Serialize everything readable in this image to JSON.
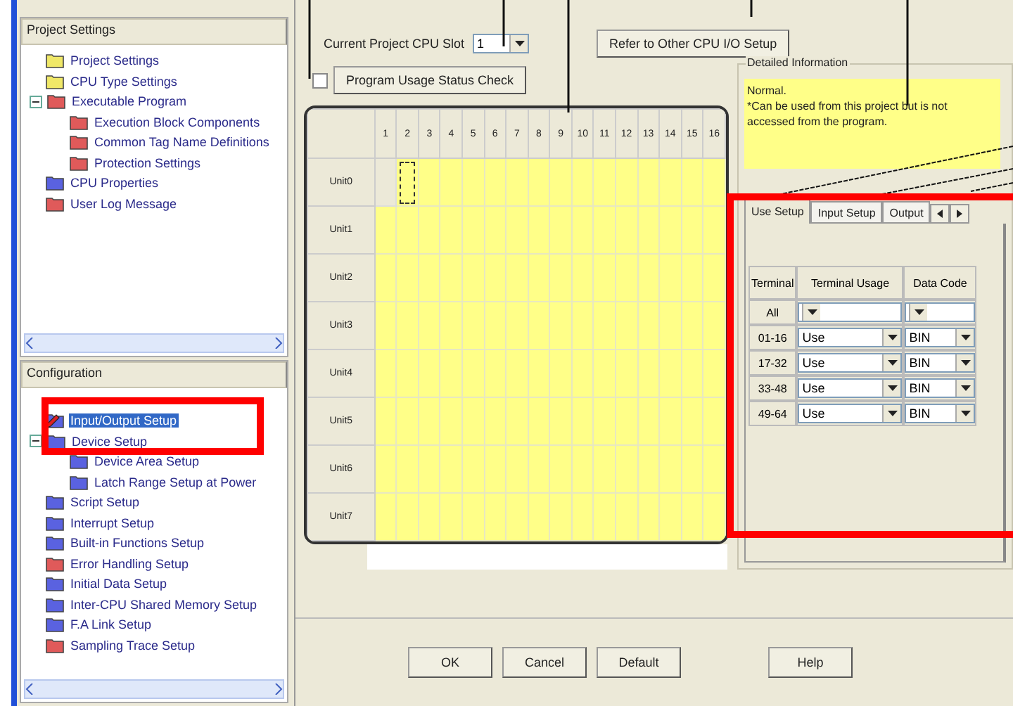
{
  "project_settings": {
    "title": "Project Settings",
    "items": [
      {
        "label": "Project Settings",
        "color": "#f0e868",
        "expanded": false
      },
      {
        "label": "CPU Type Settings",
        "color": "#f0e868",
        "expanded": false
      },
      {
        "label": "Executable Program",
        "color": "#e05a5a",
        "expanded": true,
        "children": [
          {
            "label": "Execution Block Components",
            "color": "#e05a5a"
          },
          {
            "label": "Common Tag Name Definitions",
            "color": "#e05a5a"
          },
          {
            "label": "Protection Settings",
            "color": "#e05a5a"
          }
        ]
      },
      {
        "label": "CPU Properties",
        "color": "#5a62e0",
        "expanded": false
      },
      {
        "label": "User Log Message",
        "color": "#e05a5a",
        "expanded": false
      }
    ]
  },
  "configuration": {
    "title": "Configuration",
    "items": [
      {
        "label": "Input/Output Setup",
        "color": "#5a62e0",
        "selected": true,
        "expanded": false
      },
      {
        "label": "Device Setup",
        "color": "#5a62e0",
        "selected": false,
        "expanded": true,
        "children": [
          {
            "label": "Device Area Setup",
            "color": "#5a62e0",
            "selected": false
          },
          {
            "label": "Latch Range Setup at Power",
            "color": "#5a62e0",
            "selected": false
          }
        ]
      },
      {
        "label": "Script Setup",
        "color": "#5a62e0",
        "selected": false,
        "expanded": false
      },
      {
        "label": "Interrupt Setup",
        "color": "#5a62e0",
        "selected": false,
        "expanded": false
      },
      {
        "label": "Built-in Functions Setup",
        "color": "#5a62e0",
        "selected": false,
        "expanded": false
      },
      {
        "label": "Error Handling Setup",
        "color": "#e05a5a",
        "selected": false,
        "expanded": false
      },
      {
        "label": "Initial Data Setup",
        "color": "#5a62e0",
        "selected": false,
        "expanded": false
      },
      {
        "label": "Inter-CPU Shared Memory Setup",
        "color": "#5a62e0",
        "selected": false,
        "expanded": false
      },
      {
        "label": "F.A Link Setup",
        "color": "#5a62e0",
        "selected": false,
        "expanded": false
      },
      {
        "label": "Sampling Trace Setup",
        "color": "#e05a5a",
        "selected": false,
        "expanded": false
      }
    ]
  },
  "cpu_slot": {
    "label": "Current Project CPU Slot",
    "value": "1"
  },
  "refer_button": "Refer to Other CPU I/O Setup",
  "usage_check": {
    "checked": false,
    "button": "Program Usage Status Check"
  },
  "grid": {
    "columns": [
      "1",
      "2",
      "3",
      "4",
      "5",
      "6",
      "7",
      "8",
      "9",
      "10",
      "11",
      "12",
      "13",
      "14",
      "15",
      "16"
    ],
    "rows": [
      {
        "label": "Unit0",
        "cells": [
          {
            "filled": false,
            "focused": false
          },
          {
            "filled": true,
            "focused": true
          },
          {
            "filled": true,
            "focused": false
          },
          {
            "filled": true,
            "focused": false
          },
          {
            "filled": true,
            "focused": false
          },
          {
            "filled": true,
            "focused": false
          },
          {
            "filled": true,
            "focused": false
          },
          {
            "filled": true,
            "focused": false
          },
          {
            "filled": true,
            "focused": false
          },
          {
            "filled": true,
            "focused": false
          },
          {
            "filled": true,
            "focused": false
          },
          {
            "filled": true,
            "focused": false
          },
          {
            "filled": true,
            "focused": false
          },
          {
            "filled": true,
            "focused": false
          },
          {
            "filled": true,
            "focused": false
          },
          {
            "filled": true,
            "focused": false
          }
        ]
      },
      {
        "label": "Unit1",
        "cells": [
          {
            "filled": true,
            "focused": false
          },
          {
            "filled": true,
            "focused": false
          },
          {
            "filled": true,
            "focused": false
          },
          {
            "filled": true,
            "focused": false
          },
          {
            "filled": true,
            "focused": false
          },
          {
            "filled": true,
            "focused": false
          },
          {
            "filled": true,
            "focused": false
          },
          {
            "filled": true,
            "focused": false
          },
          {
            "filled": true,
            "focused": false
          },
          {
            "filled": true,
            "focused": false
          },
          {
            "filled": true,
            "focused": false
          },
          {
            "filled": true,
            "focused": false
          },
          {
            "filled": true,
            "focused": false
          },
          {
            "filled": true,
            "focused": false
          },
          {
            "filled": true,
            "focused": false
          },
          {
            "filled": true,
            "focused": false
          }
        ]
      },
      {
        "label": "Unit2",
        "cells": [
          {
            "filled": true,
            "focused": false
          },
          {
            "filled": true,
            "focused": false
          },
          {
            "filled": true,
            "focused": false
          },
          {
            "filled": true,
            "focused": false
          },
          {
            "filled": true,
            "focused": false
          },
          {
            "filled": true,
            "focused": false
          },
          {
            "filled": true,
            "focused": false
          },
          {
            "filled": true,
            "focused": false
          },
          {
            "filled": true,
            "focused": false
          },
          {
            "filled": true,
            "focused": false
          },
          {
            "filled": true,
            "focused": false
          },
          {
            "filled": true,
            "focused": false
          },
          {
            "filled": true,
            "focused": false
          },
          {
            "filled": true,
            "focused": false
          },
          {
            "filled": true,
            "focused": false
          },
          {
            "filled": true,
            "focused": false
          }
        ]
      },
      {
        "label": "Unit3",
        "cells": [
          {
            "filled": true,
            "focused": false
          },
          {
            "filled": true,
            "focused": false
          },
          {
            "filled": true,
            "focused": false
          },
          {
            "filled": true,
            "focused": false
          },
          {
            "filled": true,
            "focused": false
          },
          {
            "filled": true,
            "focused": false
          },
          {
            "filled": true,
            "focused": false
          },
          {
            "filled": true,
            "focused": false
          },
          {
            "filled": true,
            "focused": false
          },
          {
            "filled": true,
            "focused": false
          },
          {
            "filled": true,
            "focused": false
          },
          {
            "filled": true,
            "focused": false
          },
          {
            "filled": true,
            "focused": false
          },
          {
            "filled": true,
            "focused": false
          },
          {
            "filled": true,
            "focused": false
          },
          {
            "filled": true,
            "focused": false
          }
        ]
      },
      {
        "label": "Unit4",
        "cells": [
          {
            "filled": true,
            "focused": false
          },
          {
            "filled": true,
            "focused": false
          },
          {
            "filled": true,
            "focused": false
          },
          {
            "filled": true,
            "focused": false
          },
          {
            "filled": true,
            "focused": false
          },
          {
            "filled": true,
            "focused": false
          },
          {
            "filled": true,
            "focused": false
          },
          {
            "filled": true,
            "focused": false
          },
          {
            "filled": true,
            "focused": false
          },
          {
            "filled": true,
            "focused": false
          },
          {
            "filled": true,
            "focused": false
          },
          {
            "filled": true,
            "focused": false
          },
          {
            "filled": true,
            "focused": false
          },
          {
            "filled": true,
            "focused": false
          },
          {
            "filled": true,
            "focused": false
          },
          {
            "filled": true,
            "focused": false
          }
        ]
      },
      {
        "label": "Unit5",
        "cells": [
          {
            "filled": true,
            "focused": false
          },
          {
            "filled": true,
            "focused": false
          },
          {
            "filled": true,
            "focused": false
          },
          {
            "filled": true,
            "focused": false
          },
          {
            "filled": true,
            "focused": false
          },
          {
            "filled": true,
            "focused": false
          },
          {
            "filled": true,
            "focused": false
          },
          {
            "filled": true,
            "focused": false
          },
          {
            "filled": true,
            "focused": false
          },
          {
            "filled": true,
            "focused": false
          },
          {
            "filled": true,
            "focused": false
          },
          {
            "filled": true,
            "focused": false
          },
          {
            "filled": true,
            "focused": false
          },
          {
            "filled": true,
            "focused": false
          },
          {
            "filled": true,
            "focused": false
          },
          {
            "filled": true,
            "focused": false
          }
        ]
      },
      {
        "label": "Unit6",
        "cells": [
          {
            "filled": true,
            "focused": false
          },
          {
            "filled": true,
            "focused": false
          },
          {
            "filled": true,
            "focused": false
          },
          {
            "filled": true,
            "focused": false
          },
          {
            "filled": true,
            "focused": false
          },
          {
            "filled": true,
            "focused": false
          },
          {
            "filled": true,
            "focused": false
          },
          {
            "filled": true,
            "focused": false
          },
          {
            "filled": true,
            "focused": false
          },
          {
            "filled": true,
            "focused": false
          },
          {
            "filled": true,
            "focused": false
          },
          {
            "filled": true,
            "focused": false
          },
          {
            "filled": true,
            "focused": false
          },
          {
            "filled": true,
            "focused": false
          },
          {
            "filled": true,
            "focused": false
          },
          {
            "filled": true,
            "focused": false
          }
        ]
      },
      {
        "label": "Unit7",
        "cells": [
          {
            "filled": true,
            "focused": false
          },
          {
            "filled": true,
            "focused": false
          },
          {
            "filled": true,
            "focused": false
          },
          {
            "filled": true,
            "focused": false
          },
          {
            "filled": true,
            "focused": false
          },
          {
            "filled": true,
            "focused": false
          },
          {
            "filled": true,
            "focused": false
          },
          {
            "filled": true,
            "focused": false
          },
          {
            "filled": true,
            "focused": false
          },
          {
            "filled": true,
            "focused": false
          },
          {
            "filled": true,
            "focused": false
          },
          {
            "filled": true,
            "focused": false
          },
          {
            "filled": true,
            "focused": false
          },
          {
            "filled": true,
            "focused": false
          },
          {
            "filled": true,
            "focused": false
          },
          {
            "filled": true,
            "focused": false
          }
        ]
      }
    ]
  },
  "detail": {
    "title": "Detailed Information",
    "lines": [
      "Normal.",
      "*Can be used from this project but is not accessed from the program."
    ]
  },
  "tabs": [
    {
      "label": "Use Setup",
      "selected": true
    },
    {
      "label": "Input Setup",
      "selected": false
    },
    {
      "label": "Output",
      "selected": false
    }
  ],
  "terminal_table": {
    "columns": [
      "Terminal",
      "Terminal Usage",
      "Data Code"
    ],
    "rows": [
      {
        "terminal": "All"
      },
      {
        "terminal": "01-16",
        "usage": "Use",
        "code": "BIN"
      },
      {
        "terminal": "17-32",
        "usage": "Use",
        "code": "BIN"
      },
      {
        "terminal": "33-48",
        "usage": "Use",
        "code": "BIN"
      },
      {
        "terminal": "49-64",
        "usage": "Use",
        "code": "BIN"
      }
    ]
  },
  "buttons": [
    "OK",
    "Cancel",
    "Default",
    "Help"
  ]
}
